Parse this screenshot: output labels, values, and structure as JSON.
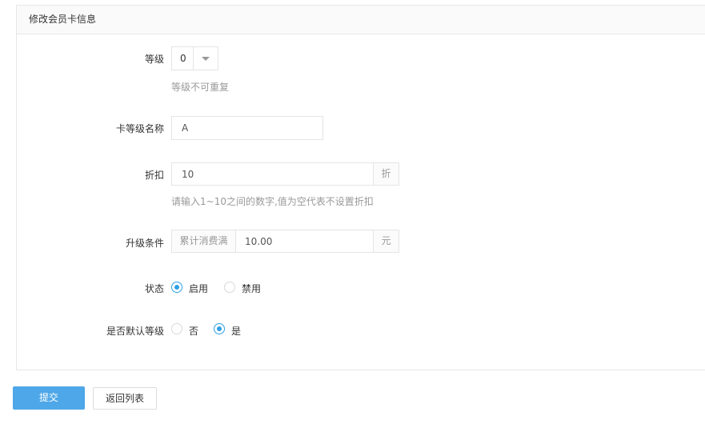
{
  "panel": {
    "title": "修改会员卡信息"
  },
  "form": {
    "level": {
      "label": "等级",
      "value": "0",
      "hint": "等级不可重复"
    },
    "name": {
      "label": "卡等级名称",
      "value": "A"
    },
    "discount": {
      "label": "折扣",
      "value": "10",
      "suffix": "折",
      "hint": "请输入1~10之间的数字,值为空代表不设置折扣"
    },
    "upgrade": {
      "label": "升级条件",
      "prefix": "累计消费满",
      "value": "10.00",
      "suffix": "元"
    },
    "status": {
      "label": "状态",
      "options": [
        "启用",
        "禁用"
      ],
      "selected": "启用"
    },
    "default_level": {
      "label": "是否默认等级",
      "options": [
        "否",
        "是"
      ],
      "selected": "是"
    }
  },
  "buttons": {
    "submit": "提交",
    "back": "返回列表"
  },
  "colors": {
    "primary": "#4ea7e8",
    "radio_checked": "#2e9fe6"
  }
}
